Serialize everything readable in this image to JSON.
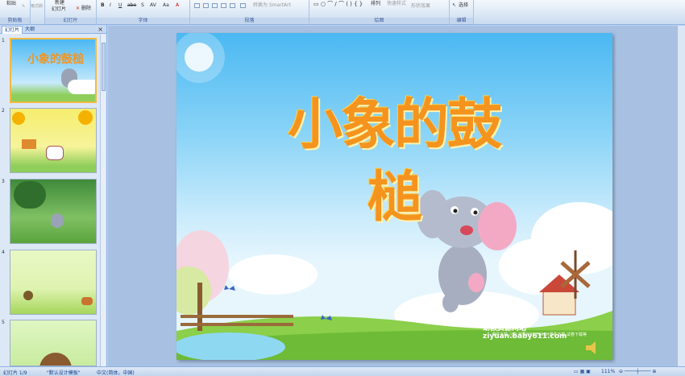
{
  "ribbon": {
    "clipboard": {
      "paste": "粘贴",
      "format_painter": "格式刷",
      "label": "剪贴板"
    },
    "slides": {
      "new_slide_line1": "新建",
      "new_slide_line2": "幻灯片",
      "delete": "删除",
      "label": "幻灯片"
    },
    "font": {
      "label": "字体"
    },
    "paragraph": {
      "smartart": "转换为 SmartArt",
      "label": "段落"
    },
    "drawing": {
      "arrange": "排列",
      "quick_styles": "快速样式",
      "shape_effects": "形状效果",
      "label": "绘图"
    },
    "editing": {
      "select": "选择",
      "label": "编辑"
    }
  },
  "panel": {
    "tab_slides": "幻灯片",
    "tab_outline": "大纲",
    "close": "×",
    "thumb_title": "小象的鼓槌",
    "thumbnails": [
      {
        "num": "1"
      },
      {
        "num": "2"
      },
      {
        "num": "3"
      },
      {
        "num": "4"
      },
      {
        "num": "5"
      }
    ]
  },
  "slide": {
    "title": "小象的鼓槌",
    "site_line": "幼教资源网站  ziyuan.baby611.com",
    "site_sub": "课件下载   儿歌   故事MP3   FLASH课件下载   试卷下载等"
  },
  "status": {
    "slide_count": "幻灯片 1/9",
    "theme": "\"默认设计模板\"",
    "language": "中文(简体，中国)",
    "zoom": "111%"
  },
  "colors": {
    "title": "#f4941e",
    "ribbon_bg": "#dbe7f5",
    "accent": "#15428b"
  }
}
